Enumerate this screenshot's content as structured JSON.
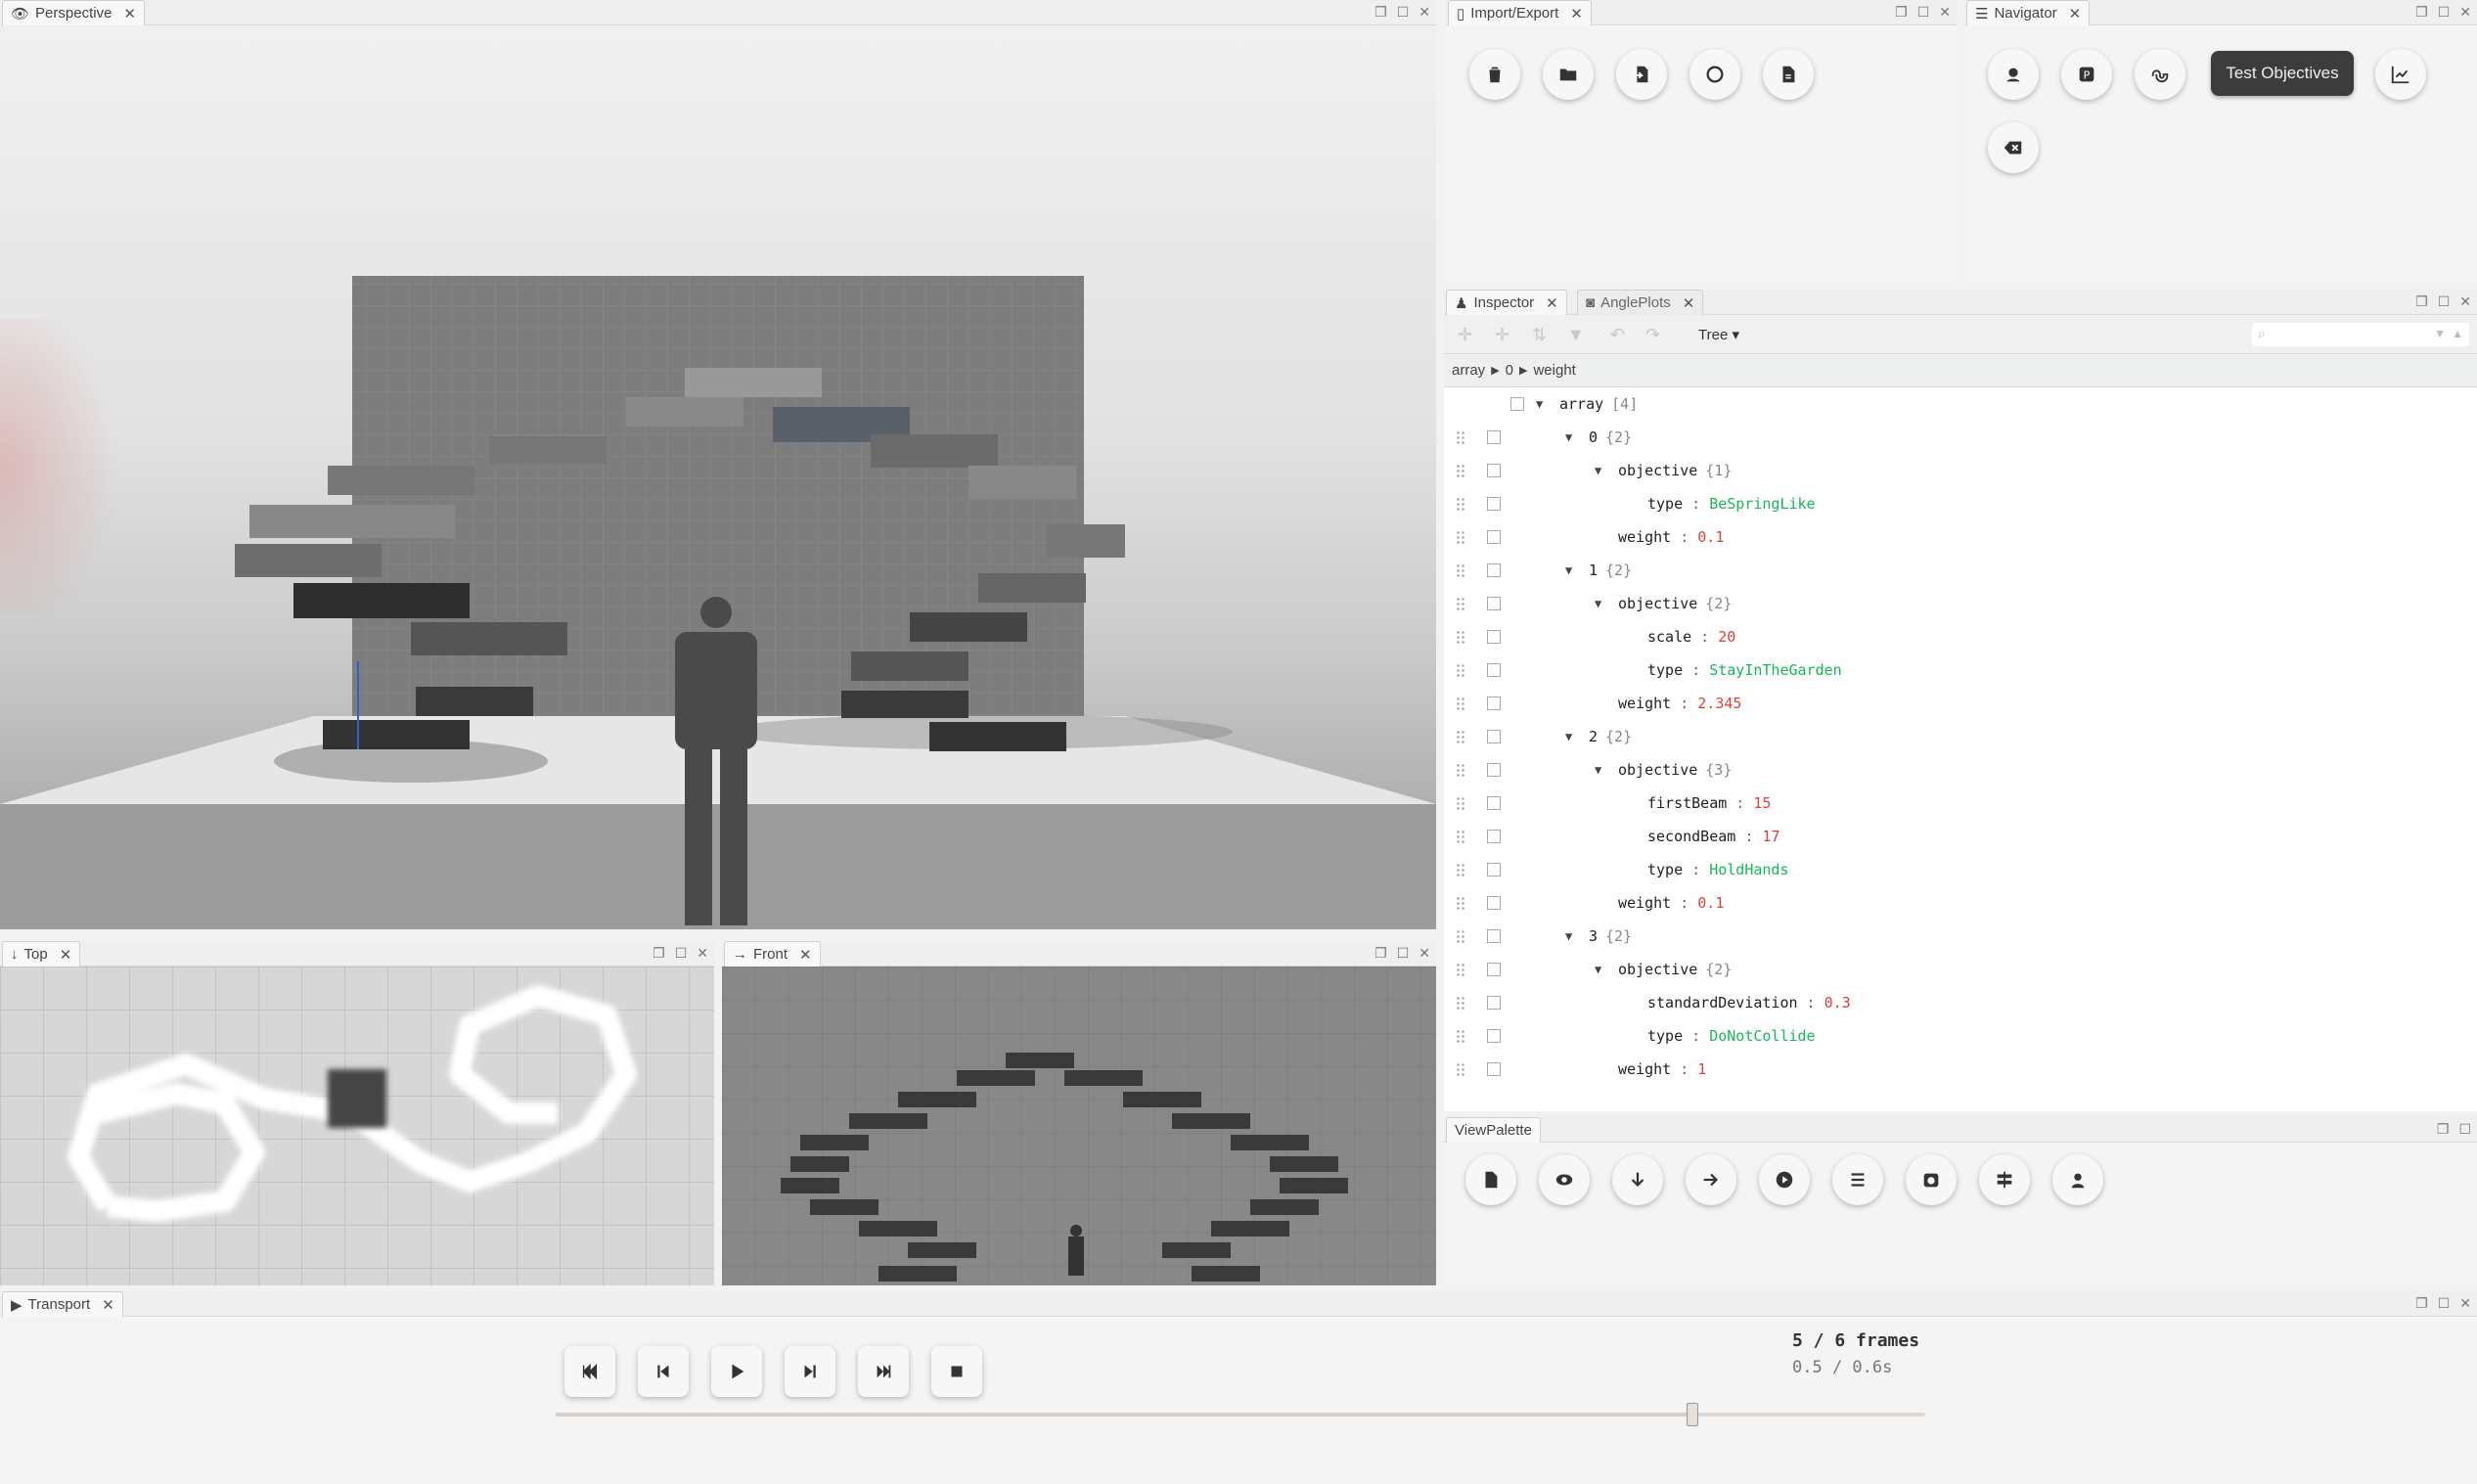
{
  "perspective": {
    "tab": "Perspective"
  },
  "top_view": {
    "tab": "Top"
  },
  "front_view": {
    "tab": "Front"
  },
  "import_export": {
    "tab": "Import/Export",
    "buttons": [
      "trash-icon",
      "folder-open-icon",
      "file-import-icon",
      "circle-icon",
      "file-icon"
    ]
  },
  "navigator": {
    "tab": "Navigator",
    "test_objectives_label": "Test Objectives"
  },
  "inspector": {
    "tabs": [
      "Inspector",
      "AnglePlots"
    ],
    "mode": "Tree",
    "breadcrumb": [
      "array",
      "0",
      "weight"
    ],
    "rows": [
      {
        "indent": 0,
        "caret": true,
        "key": "array",
        "meta": "[4]",
        "value": "",
        "vtype": ""
      },
      {
        "indent": 1,
        "caret": true,
        "key": "0",
        "meta": "{2}",
        "value": "",
        "vtype": ""
      },
      {
        "indent": 2,
        "caret": true,
        "key": "objective",
        "meta": "{1}",
        "value": "",
        "vtype": ""
      },
      {
        "indent": 3,
        "caret": false,
        "key": "type",
        "meta": "",
        "value": "BeSpringLike",
        "vtype": "str"
      },
      {
        "indent": 2,
        "caret": false,
        "key": "weight",
        "meta": "",
        "value": "0.1",
        "vtype": "num"
      },
      {
        "indent": 1,
        "caret": true,
        "key": "1",
        "meta": "{2}",
        "value": "",
        "vtype": ""
      },
      {
        "indent": 2,
        "caret": true,
        "key": "objective",
        "meta": "{2}",
        "value": "",
        "vtype": ""
      },
      {
        "indent": 3,
        "caret": false,
        "key": "scale",
        "meta": "",
        "value": "20",
        "vtype": "num"
      },
      {
        "indent": 3,
        "caret": false,
        "key": "type",
        "meta": "",
        "value": "StayInTheGarden",
        "vtype": "str"
      },
      {
        "indent": 2,
        "caret": false,
        "key": "weight",
        "meta": "",
        "value": "2.345",
        "vtype": "num"
      },
      {
        "indent": 1,
        "caret": true,
        "key": "2",
        "meta": "{2}",
        "value": "",
        "vtype": ""
      },
      {
        "indent": 2,
        "caret": true,
        "key": "objective",
        "meta": "{3}",
        "value": "",
        "vtype": ""
      },
      {
        "indent": 3,
        "caret": false,
        "key": "firstBeam",
        "meta": "",
        "value": "15",
        "vtype": "num"
      },
      {
        "indent": 3,
        "caret": false,
        "key": "secondBeam",
        "meta": "",
        "value": "17",
        "vtype": "num"
      },
      {
        "indent": 3,
        "caret": false,
        "key": "type",
        "meta": "",
        "value": "HoldHands",
        "vtype": "str"
      },
      {
        "indent": 2,
        "caret": false,
        "key": "weight",
        "meta": "",
        "value": "0.1",
        "vtype": "num"
      },
      {
        "indent": 1,
        "caret": true,
        "key": "3",
        "meta": "{2}",
        "value": "",
        "vtype": ""
      },
      {
        "indent": 2,
        "caret": true,
        "key": "objective",
        "meta": "{2}",
        "value": "",
        "vtype": ""
      },
      {
        "indent": 3,
        "caret": false,
        "key": "standardDeviation",
        "meta": "",
        "value": "0.3",
        "vtype": "num"
      },
      {
        "indent": 3,
        "caret": false,
        "key": "type",
        "meta": "",
        "value": "DoNotCollide",
        "vtype": "str"
      },
      {
        "indent": 2,
        "caret": false,
        "key": "weight",
        "meta": "",
        "value": "1",
        "vtype": "num"
      }
    ]
  },
  "view_palette": {
    "tab": "ViewPalette"
  },
  "transport": {
    "tab": "Transport",
    "frames": "5 / 6 frames",
    "time": "0.5 / 0.6s",
    "progress": 0.83
  }
}
